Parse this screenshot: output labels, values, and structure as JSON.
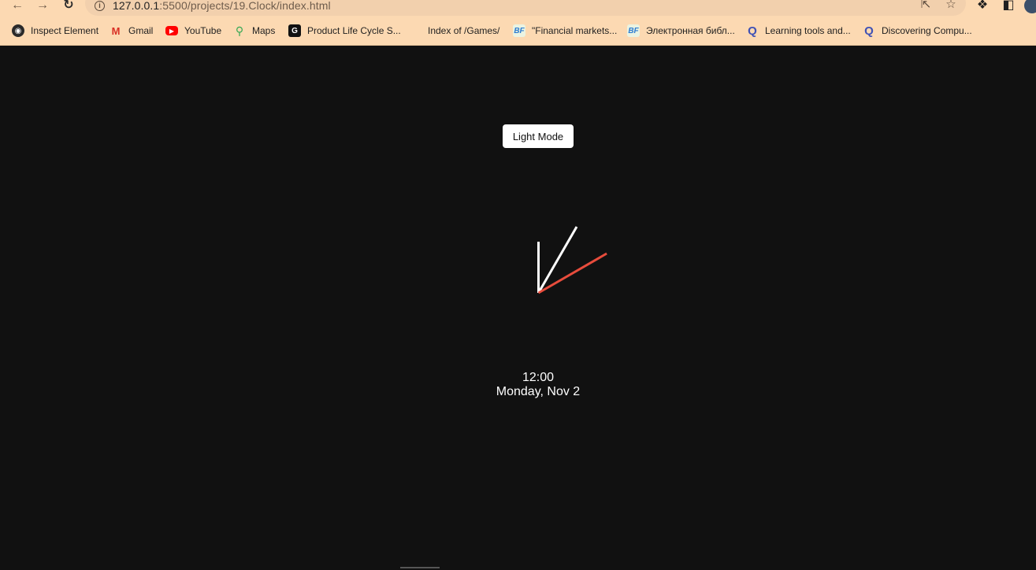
{
  "browser": {
    "url_host": "127.0.0.1",
    "url_path": ":5500/projects/19.Clock/index.html",
    "bookmarks": [
      {
        "label": "Inspect Element",
        "icon": "globe-icon"
      },
      {
        "label": "Gmail",
        "icon": "gmail-icon"
      },
      {
        "label": "YouTube",
        "icon": "youtube-icon"
      },
      {
        "label": "Maps",
        "icon": "maps-icon"
      },
      {
        "label": "Product Life Cycle S...",
        "icon": "g-icon"
      },
      {
        "label": "Index of /Games/",
        "icon": ""
      },
      {
        "label": "\"Financial markets...",
        "icon": "bf-icon"
      },
      {
        "label": "Электронная библ...",
        "icon": "bf-icon"
      },
      {
        "label": "Learning tools and...",
        "icon": "q-icon"
      },
      {
        "label": "Discovering Compu...",
        "icon": "q-icon"
      }
    ]
  },
  "app": {
    "toggle_label": "Light Mode",
    "time_text": "12:00",
    "date_text": "Monday, Nov 2",
    "hands": {
      "hour_deg": 0,
      "minute_deg": 30,
      "second_deg": 60
    },
    "colors": {
      "background": "#111111",
      "hand": "#ffffff",
      "second_hand": "#e74c3c"
    }
  }
}
